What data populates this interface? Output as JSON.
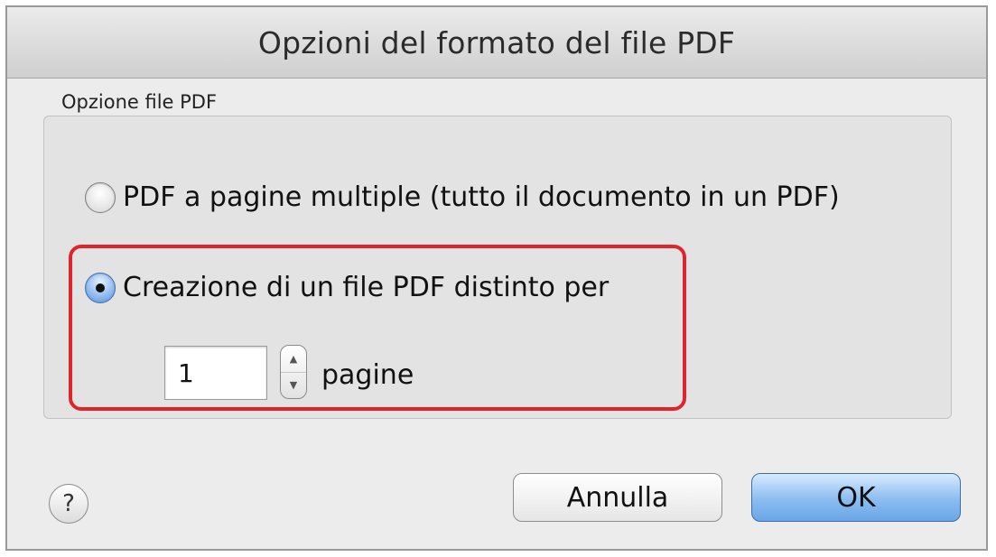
{
  "window": {
    "title": "Opzioni del formato del file PDF"
  },
  "group": {
    "label": "Opzione file PDF",
    "options": [
      {
        "label": "PDF a pagine multiple (tutto il documento in un PDF)",
        "selected": false
      },
      {
        "label": "Creazione di un file PDF distinto per",
        "selected": true
      }
    ],
    "pages_value": "1",
    "pages_unit": "pagine"
  },
  "buttons": {
    "help_label": "?",
    "cancel_label": "Annulla",
    "ok_label": "OK"
  },
  "icons": {
    "stepper_up": "chevron-up-icon",
    "stepper_down": "chevron-down-icon"
  },
  "colors": {
    "highlight": "#e0242b",
    "accent": "#6aa6e6"
  }
}
